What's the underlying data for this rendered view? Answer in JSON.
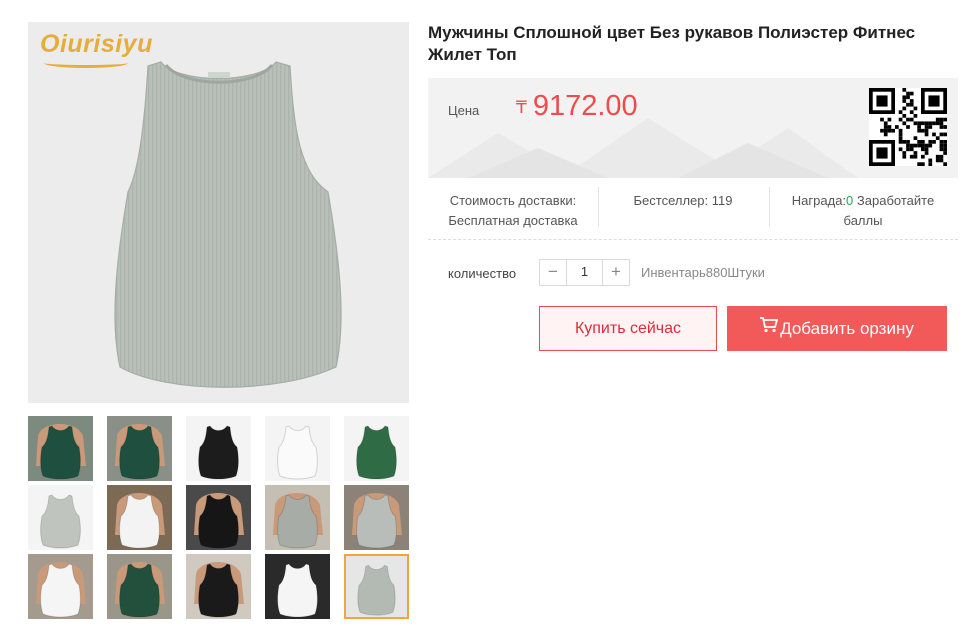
{
  "product": {
    "title": "Мужчины Сплошной цвет Без рукавов Полиэстер Фитнес Жилет Топ",
    "brand_logo_text": "Oiurisiyu",
    "main_image": "gray-sleeveless-tank-top"
  },
  "price": {
    "label": "Цена",
    "currency": "₸",
    "value": "9172.00",
    "color": "#f04b4b",
    "qr_icon": "qr-code-icon"
  },
  "stats": {
    "shipping": {
      "label": "Стоимость доставки:",
      "value": "Бесплатная доставка"
    },
    "bestseller": {
      "label": "Бестселлер:",
      "value": "119"
    },
    "reward": {
      "label": "Награда:",
      "value": "0",
      "suffix": "Заработайте баллы"
    }
  },
  "quantity": {
    "label": "количество",
    "value": "1",
    "minus": "−",
    "plus": "+",
    "inventory": "Инвентарь880Штуки"
  },
  "actions": {
    "buy_now": "Купить сейчас",
    "add_to_cart": "Добавить орзину",
    "accent": "#f25a5a"
  },
  "thumbnails": [
    {
      "name": "green-tank-model-front"
    },
    {
      "name": "green-tank-model-side"
    },
    {
      "name": "black-tank-flat"
    },
    {
      "name": "white-tank-flat"
    },
    {
      "name": "green-tank-flat"
    },
    {
      "name": "gray-tank-flat"
    },
    {
      "name": "white-tank-model"
    },
    {
      "name": "black-tank-model"
    },
    {
      "name": "gray-tank-model-back"
    },
    {
      "name": "gray-tank-model-side"
    },
    {
      "name": "white-tank-model-group"
    },
    {
      "name": "green-tank-model-group"
    },
    {
      "name": "black-tank-model-group"
    },
    {
      "name": "white-tank-flat-dark"
    },
    {
      "name": "gray-tank-flat-selected",
      "selected": true
    }
  ]
}
